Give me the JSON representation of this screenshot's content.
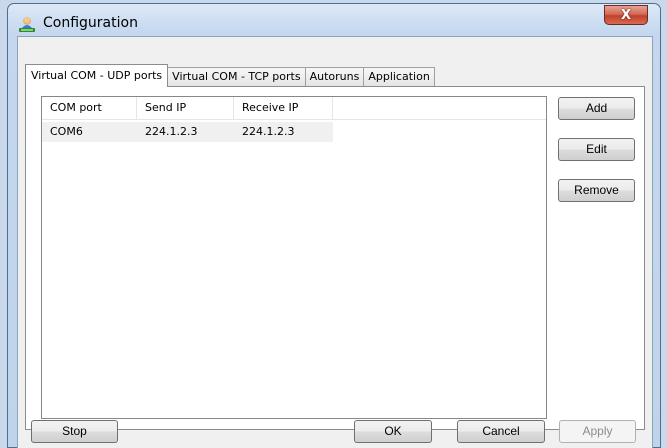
{
  "window": {
    "title": "Configuration",
    "close_glyph": "X"
  },
  "tabs": [
    {
      "label": "Virtual COM - UDP ports",
      "active": true
    },
    {
      "label": "Virtual COM - TCP ports",
      "active": false
    },
    {
      "label": "Autoruns",
      "active": false
    },
    {
      "label": "Application",
      "active": false
    }
  ],
  "table": {
    "columns": [
      "COM port",
      "Send IP",
      "Receive IP"
    ],
    "rows": [
      [
        "COM6",
        "224.1.2.3",
        "224.1.2.3"
      ]
    ]
  },
  "side_buttons": {
    "add": "Add",
    "edit": "Edit",
    "remove": "Remove"
  },
  "bottom_buttons": {
    "stop": "Stop",
    "ok": "OK",
    "cancel": "Cancel",
    "apply": "Apply"
  }
}
